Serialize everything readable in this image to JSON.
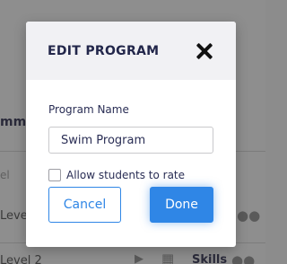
{
  "background": {
    "heading_fragment": "mmin",
    "label_fragment": "el",
    "row1_fragment": "Level",
    "row2_fragment": "Level 2",
    "row2_skills": "Skills"
  },
  "modal": {
    "title": "EDIT PROGRAM",
    "program_name_label": "Program Name",
    "program_name_value": "Swim Program",
    "allow_rate_label": "Allow students to rate",
    "allow_rate_checked": false,
    "cancel_label": "Cancel",
    "done_label": "Done"
  },
  "colors": {
    "accent": "#2f86e6",
    "title": "#22264a",
    "overlay": "#8e8e8e"
  }
}
